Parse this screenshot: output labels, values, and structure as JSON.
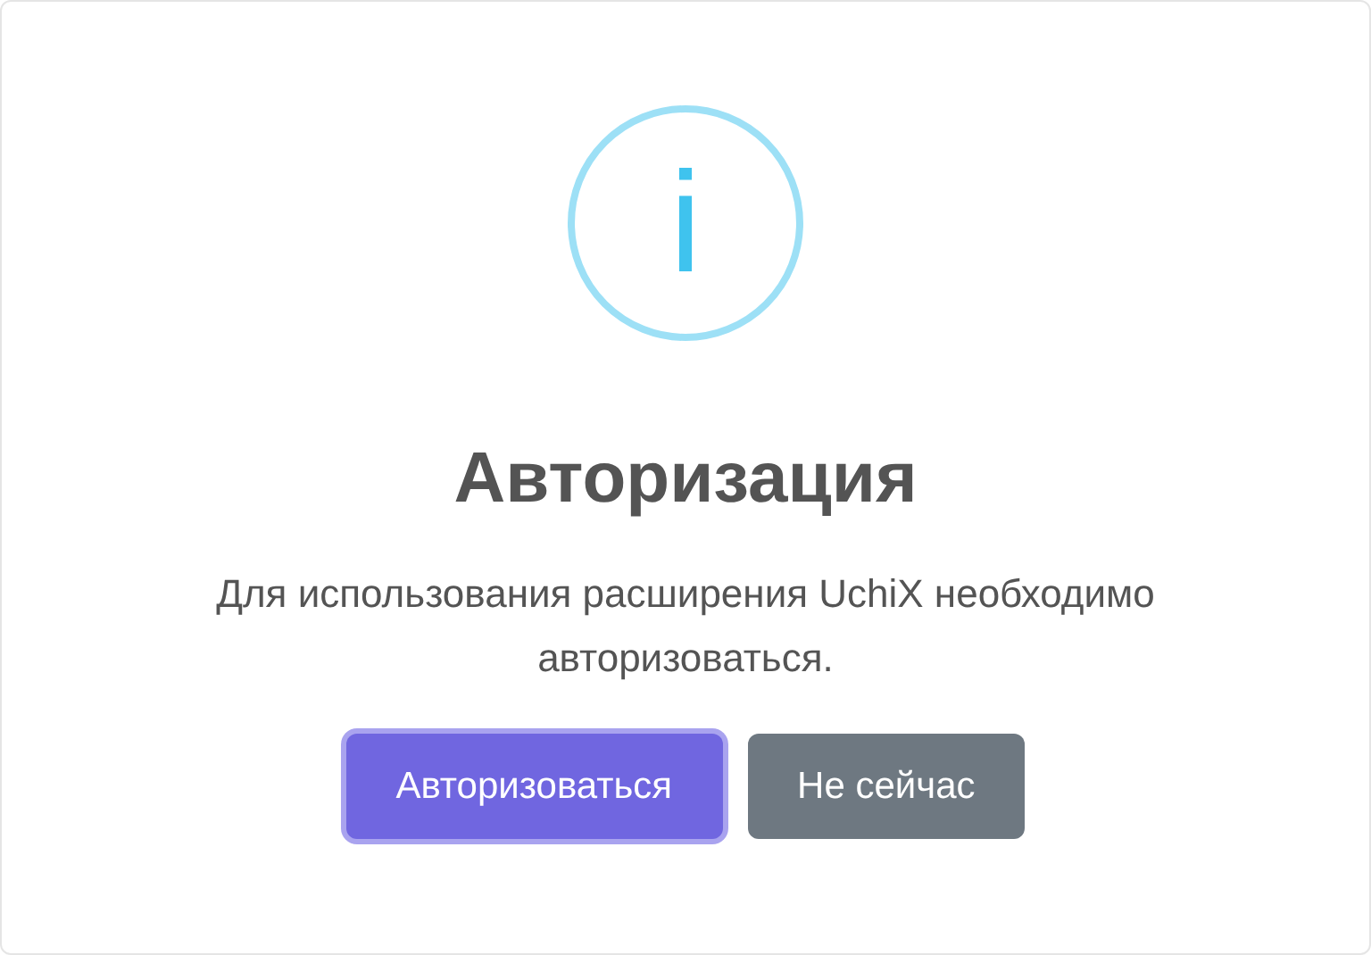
{
  "dialog": {
    "icon": {
      "glyph": "i"
    },
    "title": "Авторизация",
    "message": "Для использования расширения UchiX необходимо авторизоваться.",
    "buttons": [
      {
        "label": "Авторизоваться",
        "kind": "confirm",
        "focused": true
      },
      {
        "label": "Не сейчас",
        "kind": "cancel",
        "focused": false
      }
    ]
  }
}
